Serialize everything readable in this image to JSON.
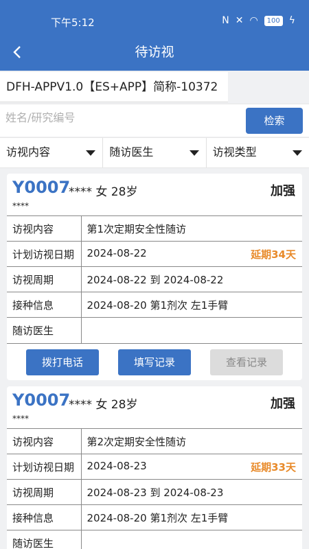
{
  "status_bar": {
    "time": "下午5:12",
    "battery": "100"
  },
  "nav": {
    "title": "待访视"
  },
  "project": {
    "name": "DFH-APPV1.0【ES+APP】简称-10372"
  },
  "search": {
    "placeholder": "姓名/研究编号",
    "button_label": "检索"
  },
  "filters": [
    {
      "label": "访视内容"
    },
    {
      "label": "随访医生"
    },
    {
      "label": "访视类型"
    }
  ],
  "field_labels": {
    "content": "访视内容",
    "plan_date": "计划访视日期",
    "period": "访视周期",
    "vaccination": "接种信息",
    "doctor": "随访医生"
  },
  "actions": {
    "call": "拨打电话",
    "fill": "填写记录",
    "view": "查看记录"
  },
  "cards": [
    {
      "id": "Y0007",
      "info": "**** 女 28岁",
      "mask": "****",
      "level": "加强",
      "content": "第1次定期安全性随访",
      "plan_date": "2024-08-22",
      "delay": "延期34天",
      "period": "2024-08-22 到 2024-08-22",
      "vaccination": "2024-08-20 第1剂次 左1手臂",
      "doctor": ""
    },
    {
      "id": "Y0007",
      "info": "**** 女 28岁",
      "mask": "****",
      "level": "加强",
      "content": "第2次定期安全性随访",
      "plan_date": "2024-08-23",
      "delay": "延期33天",
      "period": "2024-08-23 到 2024-08-23",
      "vaccination": "2024-08-20 第1剂次 左1手臂",
      "doctor": ""
    }
  ],
  "colors": {
    "primary": "#3b73c4",
    "delay": "#e88a2a",
    "background": "#f0f1f3"
  }
}
